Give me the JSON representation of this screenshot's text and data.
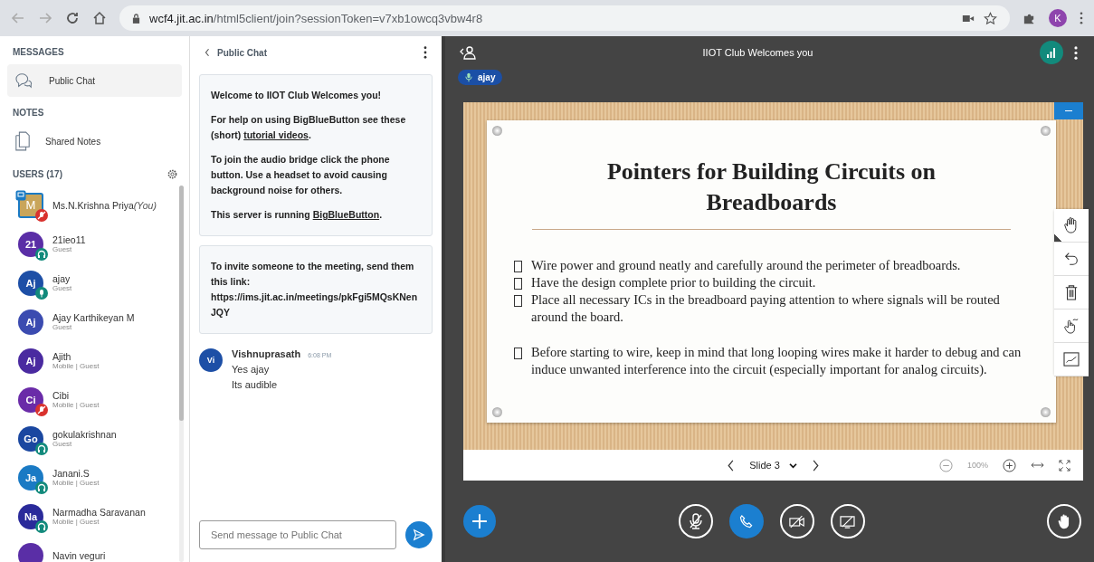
{
  "browser": {
    "url_host": "wcf4.jit.ac.in",
    "url_path": "/html5client/join?sessionToken=v7xb1owcq3vbw4r8",
    "profile_initial": "K"
  },
  "sidebar": {
    "messages_heading": "MESSAGES",
    "messages_items": [
      {
        "label": "Public Chat",
        "selected": true
      }
    ],
    "notes_heading": "NOTES",
    "notes_items": [
      {
        "label": "Shared Notes",
        "selected": false
      }
    ],
    "users_heading": "USERS (17)",
    "users": [
      {
        "initials": "M",
        "name": "Ms.N.Krishna Priya",
        "you_label": "(You)",
        "color": "#c9a55a",
        "kind": "muted",
        "presenter": true
      },
      {
        "initials": "21",
        "name": "21ieo11",
        "role": "Guest",
        "color": "#5a2ea6",
        "kind": "listen",
        "presenter": false
      },
      {
        "initials": "Aj",
        "name": "ajay",
        "role": "Guest",
        "color": "#1d4fa6",
        "kind": "mic",
        "presenter": false
      },
      {
        "initials": "Aj",
        "name": "Ajay Karthikeyan M",
        "role": "Guest",
        "color": "#3b4bb0",
        "presenter": false
      },
      {
        "initials": "Aj",
        "name": "Ajith",
        "role": "Mobile | Guest",
        "color": "#4a2aa0",
        "presenter": false
      },
      {
        "initials": "Ci",
        "name": "Cibi",
        "role": "Mobile | Guest",
        "color": "#6a2ba8",
        "kind": "muted",
        "presenter": false
      },
      {
        "initials": "Go",
        "name": "gokulakrishnan",
        "role": "Guest",
        "color": "#1a47a0",
        "kind": "listen",
        "presenter": false
      },
      {
        "initials": "Ja",
        "name": "Janani.S",
        "role": "Mobile | Guest",
        "color": "#1a7ac4",
        "kind": "listen",
        "presenter": false
      },
      {
        "initials": "Na",
        "name": "Narmadha Saravanan",
        "role": "Mobile | Guest",
        "color": "#2a2a9a",
        "kind": "listen",
        "presenter": false
      },
      {
        "name": "Navin veguri",
        "color": "#5a2ea6",
        "presenter": false
      }
    ]
  },
  "chat": {
    "title": "Public Chat",
    "welcome": {
      "title": "Welcome to IIOT Club Welcomes you!",
      "help_before": "For help on using BigBlueButton see these (short) ",
      "help_link": "tutorial videos",
      "help_after": ".",
      "audio": "To join the audio bridge click the phone button. Use a headset to avoid causing background noise for others.",
      "server_before": "This server is running ",
      "server_link": "BigBlueButton",
      "server_after": "."
    },
    "invite": "To invite someone to the meeting, send them this link: https://ims.jit.ac.in/meetings/pkFgi5MQsKNenJQY",
    "messages": [
      {
        "initials": "Vi",
        "sender": "Vishnuprasath",
        "time": "6:08 PM",
        "lines": [
          "Yes ajay",
          "Its audible"
        ]
      }
    ],
    "input": {
      "placeholder": "Send message to Public Chat"
    }
  },
  "presentation": {
    "title": "IIOT Club Welcomes you",
    "talker": "ajay",
    "slide": {
      "heading": "Pointers for Building Circuits on Breadboards",
      "bullet_groups": [
        [
          "Wire power and ground neatly and carefully around the perimeter of breadboards.",
          "Have the design complete prior to building the circuit.",
          "Place all necessary ICs in the breadboard paying attention to where signals will be routed around the board."
        ],
        [
          "Before starting to wire, keep in mind that long looping wires make it harder to debug and can induce unwanted interference into the circuit (especially important for analog circuits)."
        ]
      ]
    },
    "slide_label": "Slide 3",
    "zoom": "100%",
    "tools": [
      {
        "kind": "hand",
        "selected": true
      },
      {
        "kind": "undo",
        "selected": false
      },
      {
        "kind": "trash",
        "selected": false
      },
      {
        "kind": "multi",
        "selected": false
      },
      {
        "kind": "line",
        "selected": false
      }
    ]
  }
}
